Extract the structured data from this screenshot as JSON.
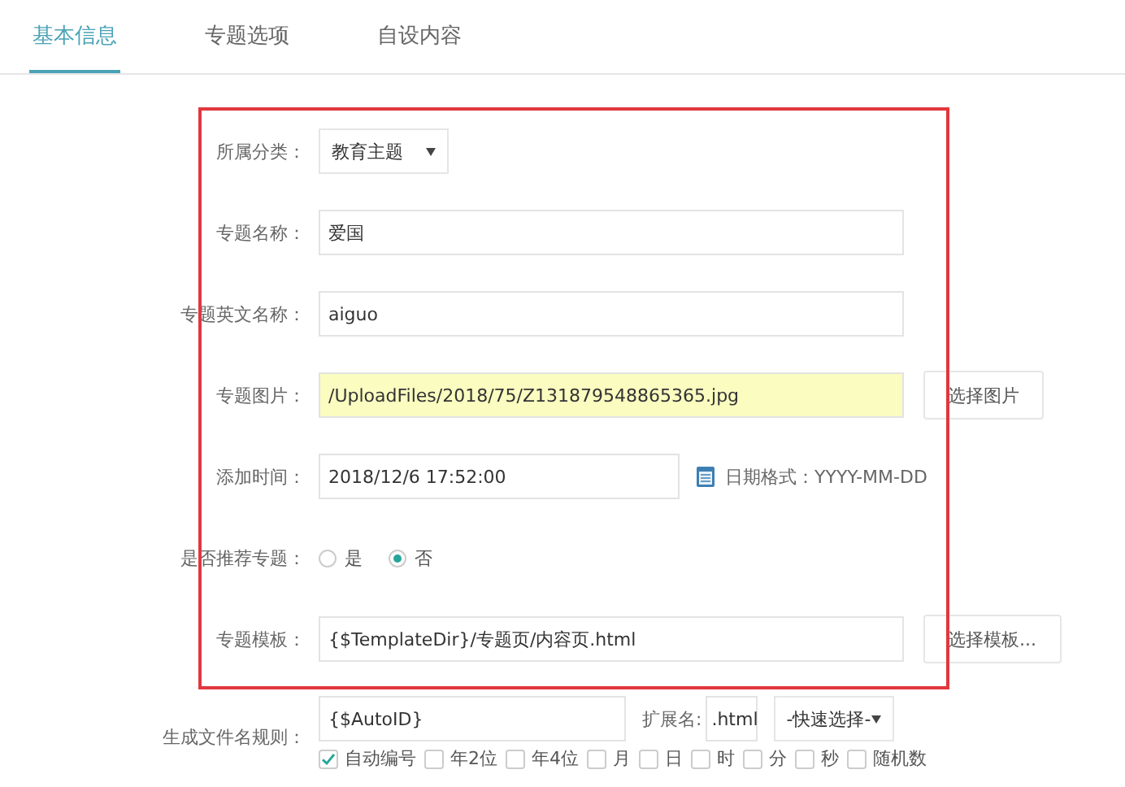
{
  "tabs": [
    {
      "label": "基本信息",
      "selected": true
    },
    {
      "label": "专题选项",
      "selected": false
    },
    {
      "label": "自设内容",
      "selected": false
    }
  ],
  "highlighted_section": [
    {
      "kind": "select",
      "label": "所属分类：",
      "value": "教育主题"
    },
    {
      "kind": "text",
      "label": "专题名称：",
      "value": "爱国"
    },
    {
      "kind": "text",
      "label": "专题英文名称：",
      "value": "aiguo"
    },
    {
      "kind": "file",
      "label": "专题图片：",
      "value": "/UploadFiles/2018/75/Z131879548865365.jpg",
      "button": "选择图片",
      "filled": true
    },
    {
      "kind": "date",
      "label": "添加时间：",
      "value": "2018/12/6 17:52:00",
      "hint": "日期格式：YYYY-MM-DD"
    },
    {
      "kind": "radio",
      "label": "是否推荐专题：",
      "options": [
        {
          "label": "是",
          "selected": false
        },
        {
          "label": "否",
          "selected": true
        }
      ]
    },
    {
      "kind": "file",
      "label": "专题模板：",
      "value": "{$TemplateDir}/专题页/内容页.html",
      "button": "选择模板...",
      "filled": false
    }
  ],
  "form": [
    {
      "kind": "rule",
      "label": "生成文件名规则：",
      "value": "{$AutoID}",
      "ext_label": "扩展名:",
      "ext_value": ".html",
      "quick": "-快速选择-",
      "options": [
        {
          "label": "自动编号",
          "checked": true
        },
        {
          "label": "年2位",
          "checked": false
        },
        {
          "label": "年4位",
          "checked": false
        },
        {
          "label": "月",
          "checked": false
        },
        {
          "label": "日",
          "checked": false
        },
        {
          "label": "时",
          "checked": false
        },
        {
          "label": "分",
          "checked": false
        },
        {
          "label": "秒",
          "checked": false
        },
        {
          "label": "随机数",
          "checked": false
        }
      ]
    }
  ]
}
